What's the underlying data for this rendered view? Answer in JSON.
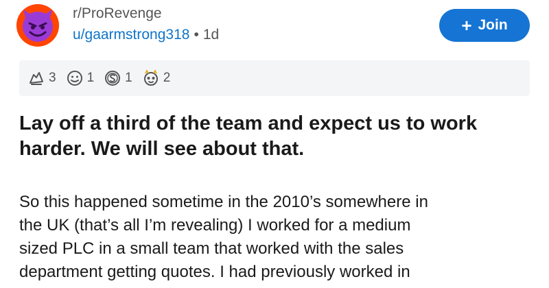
{
  "header": {
    "subreddit": "r/ProRevenge",
    "username": "u/gaarmstrong318",
    "separator": "•",
    "age": "1d",
    "join_label": "Join",
    "join_icon": "plus-icon",
    "avatar_icon": "devil-face-icon"
  },
  "awards": [
    {
      "icon": "award-hands-icon",
      "count": "3"
    },
    {
      "icon": "award-face-icon",
      "count": "1"
    },
    {
      "icon": "award-silver-icon",
      "count": "1"
    },
    {
      "icon": "award-wholesome-icon",
      "count": "2"
    }
  ],
  "post": {
    "title": "Lay off a third of the team and expect us to work harder. We will see about that.",
    "body_lines": [
      "So this happened sometime in the 2010’s somewhere in",
      "the UK (that’s all I’m revealing) I worked for a medium",
      "sized PLC in a small team that worked with the sales",
      "department getting quotes. I had previously worked in"
    ]
  },
  "colors": {
    "avatar_bg": "#ff4500",
    "avatar_face": "#9b3bd6",
    "join_bg": "#1574d4",
    "username": "#0f74c8",
    "awards_bg": "#f4f5f6"
  }
}
